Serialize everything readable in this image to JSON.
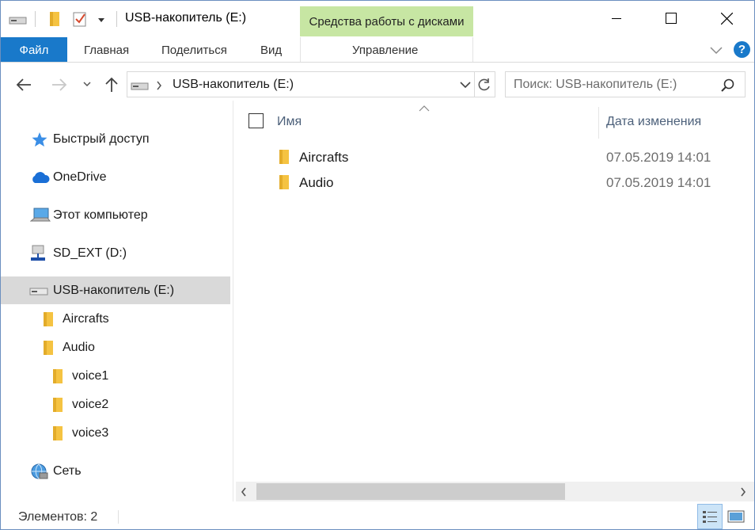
{
  "titlebar": {
    "title": "USB-накопитель (E:)",
    "context_tools_label": "Средства работы с дисками",
    "qat_icons": [
      "drive-icon",
      "folder-icon",
      "properties-check-icon",
      "customize-dropdown-icon"
    ],
    "window_controls": [
      "minimize-icon",
      "maximize-icon",
      "close-icon"
    ]
  },
  "ribbon": {
    "tabs": [
      {
        "label": "Файл",
        "active": true
      },
      {
        "label": "Главная"
      },
      {
        "label": "Поделиться"
      },
      {
        "label": "Вид"
      },
      {
        "label": "Управление"
      }
    ],
    "collapse_icon": "chevron-down-icon",
    "help_icon": "help-icon",
    "help_glyph": "?"
  },
  "address": {
    "path": "USB-накопитель (E:)",
    "search_placeholder": "Поиск: USB-накопитель (E:)",
    "nav_icons": [
      "back-arrow-icon",
      "forward-arrow-icon",
      "recent-dropdown-icon",
      "up-arrow-icon"
    ]
  },
  "nav": {
    "items": [
      {
        "label": "Быстрый доступ",
        "icon": "star-icon"
      },
      {
        "label": "OneDrive",
        "icon": "cloud-icon"
      },
      {
        "label": "Этот компьютер",
        "icon": "computer-icon"
      },
      {
        "label": "SD_EXT (D:)",
        "icon": "network-drive-icon"
      },
      {
        "label": "USB-накопитель (E:)",
        "icon": "usb-drive-icon",
        "selected": true
      },
      {
        "label": "Aircrafts",
        "icon": "folder-icon"
      },
      {
        "label": "Audio",
        "icon": "folder-icon"
      },
      {
        "label": "voice1",
        "icon": "folder-icon"
      },
      {
        "label": "voice2",
        "icon": "folder-icon"
      },
      {
        "label": "voice3",
        "icon": "folder-icon"
      },
      {
        "label": "Сеть",
        "icon": "network-icon"
      }
    ]
  },
  "files": {
    "columns": {
      "name": "Имя",
      "date": "Дата изменения"
    },
    "rows": [
      {
        "name": "Aircrafts",
        "date": "07.05.2019 14:01"
      },
      {
        "name": "Audio",
        "date": "07.05.2019 14:01"
      }
    ]
  },
  "status": {
    "items_count": "Элементов: 2"
  },
  "colors": {
    "file_tab": "#1979ca",
    "context_tools": "#c7e6a3",
    "selection": "#d9d9d9",
    "folder": "#f5c342",
    "help": "#1979ca"
  }
}
